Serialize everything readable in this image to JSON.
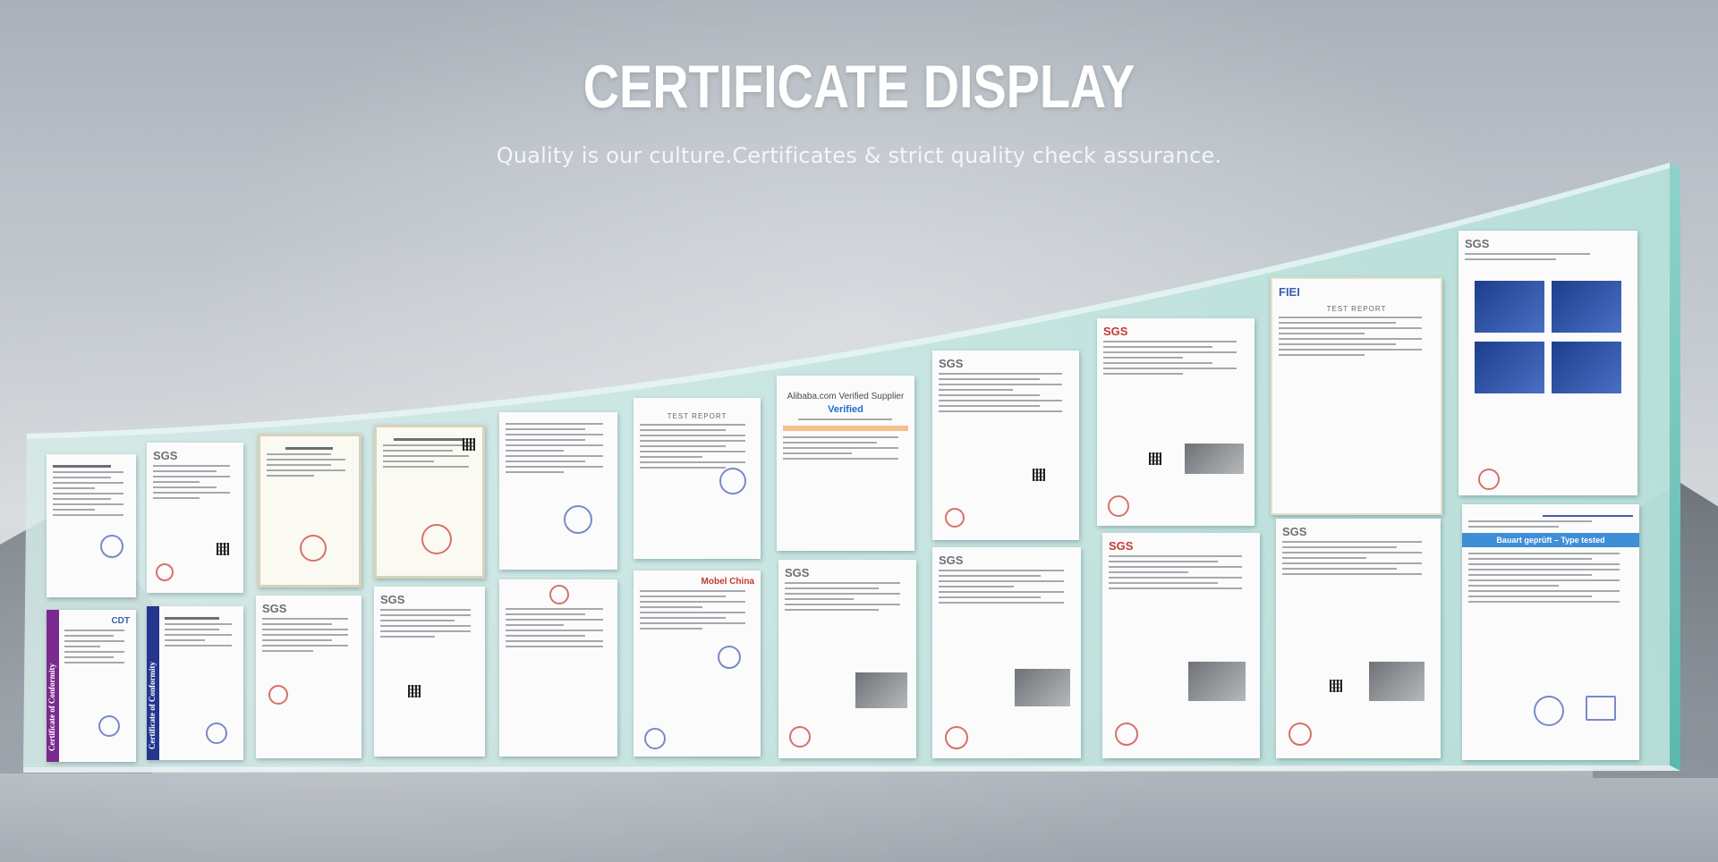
{
  "header": {
    "title": "CERTIFICATE DISPLAY",
    "subtitle": "Quality is our culture.Certificates & strict quality check assurance."
  },
  "colors": {
    "glass": "#cfe8e6",
    "glass_edge": "#7fcac0",
    "title": "#ffffff",
    "stamp_red": "#c9433a"
  },
  "certificates": {
    "top_row": [
      {
        "kind": "report",
        "header": ""
      },
      {
        "kind": "sgs",
        "header": "SGS"
      },
      {
        "kind": "chinese",
        "header": ""
      },
      {
        "kind": "chinese",
        "header": ""
      },
      {
        "kind": "report",
        "header": ""
      },
      {
        "kind": "test",
        "header": "TEST REPORT"
      },
      {
        "kind": "verified",
        "header": "Alibaba.com Verified Supplier",
        "badge": "Verified"
      },
      {
        "kind": "sgs",
        "header": "SGS"
      },
      {
        "kind": "sgs-photo",
        "header": "SGS"
      },
      {
        "kind": "fiei",
        "header": "FIEI",
        "sub": "TEST REPORT"
      },
      {
        "kind": "sgs-chairs",
        "header": "SGS"
      }
    ],
    "bottom_row": [
      {
        "kind": "conformity-purple",
        "header": "CDT",
        "band": "Certificate of Conformity"
      },
      {
        "kind": "conformity-navy",
        "header": "Certificate of Conformity",
        "band": "Certificate of Conformity"
      },
      {
        "kind": "sgs",
        "header": "SGS"
      },
      {
        "kind": "sgs",
        "header": "SGS"
      },
      {
        "kind": "report",
        "header": ""
      },
      {
        "kind": "report",
        "header": "Mobel China"
      },
      {
        "kind": "sgs-photo",
        "header": "SGS"
      },
      {
        "kind": "sgs-photo",
        "header": "SGS"
      },
      {
        "kind": "sgs-photo",
        "header": "SGS"
      },
      {
        "kind": "sgs-photo",
        "header": "SGS"
      },
      {
        "kind": "tuv",
        "header": "Bauart geprüft – Type tested"
      }
    ]
  }
}
